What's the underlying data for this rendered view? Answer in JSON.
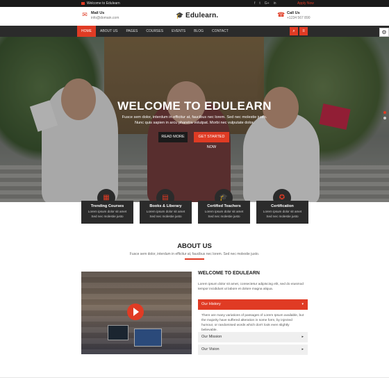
{
  "topbar": {
    "welcome": "Welcome to Edulearn",
    "social": [
      "f",
      "t",
      "G+",
      "in"
    ],
    "apply": "Apply Now"
  },
  "header": {
    "mail_title": "Mail Us",
    "mail_value": "info@domain.com",
    "logo": "Edulearn.",
    "call_title": "Call Us",
    "call_value": "+1234 567 890"
  },
  "nav": {
    "items": [
      "HOME",
      "ABOUT US",
      "PAGES",
      "COURSES",
      "EVENTS",
      "BLOG",
      "CONTACT"
    ],
    "active": "HOME"
  },
  "hero": {
    "title": "WELCOME TO EDULEARN",
    "subtitle": "Fusce sem dolor, interdum in efficitur at, faucibus nec lorem. Sed nec molestie justo. Nunc quis sapien in arcu pharetra volutpat. Morbi nec vulputate dolor.",
    "read_more": "READ MORE",
    "get_started": "GET STARTED NOW"
  },
  "features": [
    {
      "title": "Trending Courses",
      "desc": "Lorem ipsum dolor sit amet Sed nec molestie justo",
      "icon": "presentation-icon"
    },
    {
      "title": "Books & Liberary",
      "desc": "Lorem ipsum dolor sit amet Sed nec molestie justo",
      "icon": "book-icon"
    },
    {
      "title": "Certified Teachers",
      "desc": "Lorem ipsum dolor sit amet Sed nec molestie justo",
      "icon": "graduation-cap-icon"
    },
    {
      "title": "Certification",
      "desc": "Lorem ipsum dolor sit amet Sed nec molestie justo",
      "icon": "certificate-icon"
    }
  ],
  "about": {
    "title": "ABOUT US",
    "subtitle": "Fusce sem dolor, interdum in efficitur at, faucibus nec lorem. Sed nec molestie justo.",
    "welcome_title": "WELCOME TO EDULEARN",
    "welcome_text": "Lorem ipsum dolor sit amet, consectetur adipiscing elit, sed do eiusmod tempor incididunt ut labore et dolore magna aliqua.",
    "accordion": [
      {
        "label": "Our History",
        "open": true,
        "body": "There are many variations of passages of Lorem Ipsum available, but the majority have suffered alteration in some form, by injected humour, or randomised words which don't look even slightly believable."
      },
      {
        "label": "Our Mission",
        "open": false
      },
      {
        "label": "Our Vision",
        "open": false
      }
    ]
  },
  "colors": {
    "accent": "#e03b24",
    "dark": "#2b2b2b"
  }
}
